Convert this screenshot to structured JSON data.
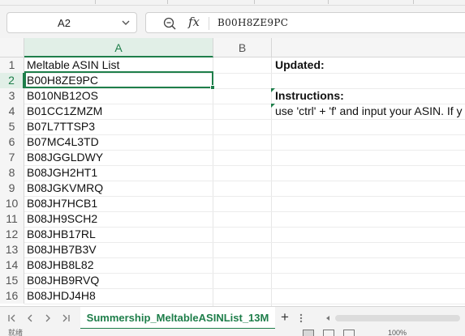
{
  "formula_bar": {
    "cell_reference": "A2",
    "fx_symbol": "fx",
    "cell_value": "B00H8ZE9PC"
  },
  "columns": [
    "A",
    "B"
  ],
  "rows": [
    {
      "num": "1",
      "a": "Meltable ASIN List",
      "c": "Updated:"
    },
    {
      "num": "2",
      "a": "B00H8ZE9PC",
      "c": ""
    },
    {
      "num": "3",
      "a": "B010NB12OS",
      "c": "Instructions:"
    },
    {
      "num": "4",
      "a": "B01CC1ZMZM",
      "c": "use 'ctrl' + 'f' and input your ASIN. If y"
    },
    {
      "num": "5",
      "a": "B07L7TTSP3",
      "c": ""
    },
    {
      "num": "6",
      "a": "B07MC4L3TD",
      "c": ""
    },
    {
      "num": "7",
      "a": "B08JGGLDWY",
      "c": ""
    },
    {
      "num": "8",
      "a": "B08JGH2HT1",
      "c": ""
    },
    {
      "num": "9",
      "a": "B08JGKVMRQ",
      "c": ""
    },
    {
      "num": "10",
      "a": "B08JH7HCB1",
      "c": ""
    },
    {
      "num": "11",
      "a": "B08JH9SCH2",
      "c": ""
    },
    {
      "num": "12",
      "a": "B08JHB17RL",
      "c": ""
    },
    {
      "num": "13",
      "a": "B08JHB7B3V",
      "c": ""
    },
    {
      "num": "14",
      "a": "B08JHB8L82",
      "c": ""
    },
    {
      "num": "15",
      "a": "B08JHB9RVQ",
      "c": ""
    },
    {
      "num": "16",
      "a": "B08JHDJ4H8",
      "c": ""
    }
  ],
  "sheet_tab": {
    "name": "Summership_MeltableASINList_13M",
    "add_label": "+"
  },
  "status_bar": {
    "left_text": "就绪",
    "zoom": "100%"
  },
  "colors": {
    "accent": "#1e7e4a",
    "selected_header_bg": "#e1efe7"
  },
  "icons": [
    "chevron-down-icon",
    "zoom-icon",
    "fx-icon",
    "first-sheet-icon",
    "prev-sheet-icon",
    "next-sheet-icon",
    "last-sheet-icon",
    "add-sheet-icon"
  ]
}
